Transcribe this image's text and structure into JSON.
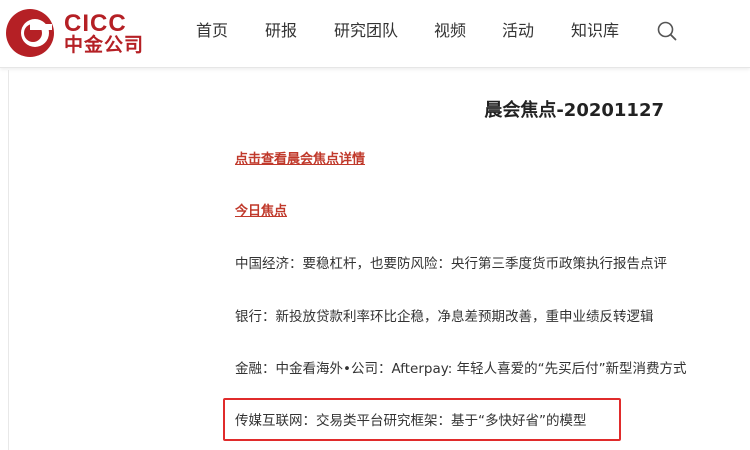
{
  "brand": {
    "name_en": "CICC",
    "name_cn": "中金公司",
    "color": "#b52025"
  },
  "nav": {
    "items": [
      {
        "label": "首页"
      },
      {
        "label": "研报"
      },
      {
        "label": "研究团队"
      },
      {
        "label": "视频"
      },
      {
        "label": "活动"
      },
      {
        "label": "知识库"
      }
    ],
    "search_icon": "search-icon"
  },
  "article": {
    "title": "晨会焦点-20201127",
    "detail_link": "点击查看晨会焦点详情",
    "today_focus": "今日焦点",
    "items": [
      "中国经济：要稳杠杆，也要防风险：央行第三季度货币政策执行报告点评",
      "银行：新投放贷款利率环比企稳，净息差预期改善，重申业绩反转逻辑",
      "金融：中金看海外•公司：Afterpay: 年轻人喜爱的“先买后付”新型消费方式",
      "传媒互联网：交易类平台研究框架：基于“多快好省”的模型"
    ],
    "highlight_color": "#e02b2b",
    "link_color": "#c0392b"
  }
}
